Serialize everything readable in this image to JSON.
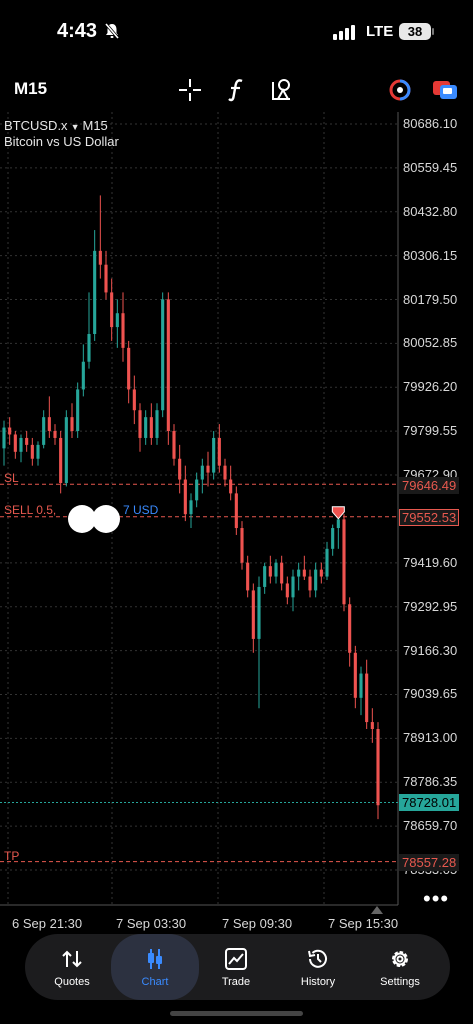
{
  "status": {
    "time": "4:43",
    "network": "LTE",
    "battery": "38"
  },
  "toolbar": {
    "timeframe": "M15",
    "icons": [
      "crosshair-icon",
      "function-icon",
      "objects-icon",
      "chart-color-icon",
      "switch-symbol-icon"
    ]
  },
  "chart_data": {
    "type": "candlestick",
    "symbol": "BTCUSD.x",
    "timeframe": "M15",
    "description": "Bitcoin vs US Dollar",
    "price_ticks": [
      "80686.10",
      "80559.45",
      "80432.80",
      "80306.15",
      "80179.50",
      "80052.85",
      "79926.20",
      "79799.55",
      "79672.90",
      "79419.60",
      "79292.95",
      "79166.30",
      "79039.65",
      "78913.00",
      "78786.35",
      "78659.70",
      "78533.05"
    ],
    "time_ticks": [
      "6 Sep 21:30",
      "7 Sep 03:30",
      "7 Sep 09:30",
      "7 Sep 15:30"
    ],
    "ylim": [
      78533.05,
      80686.1
    ],
    "current_price": "78728.01",
    "sl_price": "79646.49",
    "entry_price": "79552.53",
    "tp_price": "78557.28",
    "sl_label": "SL",
    "tp_label": "TP",
    "order_label_prefix": "SELL 0.5,",
    "order_label_suffix": "7 USD",
    "candles": [
      [
        79750,
        79830,
        79700,
        79810
      ],
      [
        79810,
        79840,
        79760,
        79790
      ],
      [
        79790,
        79800,
        79720,
        79740
      ],
      [
        79740,
        79790,
        79710,
        79780
      ],
      [
        79780,
        79800,
        79740,
        79760
      ],
      [
        79760,
        79780,
        79700,
        79720
      ],
      [
        79720,
        79770,
        79700,
        79760
      ],
      [
        79760,
        79860,
        79750,
        79840
      ],
      [
        79840,
        79900,
        79780,
        79800
      ],
      [
        79800,
        79820,
        79760,
        79780
      ],
      [
        79780,
        79800,
        79620,
        79650
      ],
      [
        79650,
        79860,
        79640,
        79840
      ],
      [
        79840,
        79880,
        79780,
        79800
      ],
      [
        79800,
        79940,
        79780,
        79920
      ],
      [
        79920,
        80050,
        79900,
        80000
      ],
      [
        80000,
        80200,
        79980,
        80080
      ],
      [
        80080,
        80380,
        80060,
        80320
      ],
      [
        80320,
        80480,
        80240,
        80280
      ],
      [
        80280,
        80320,
        80180,
        80200
      ],
      [
        80200,
        80240,
        80060,
        80100
      ],
      [
        80100,
        80180,
        80040,
        80140
      ],
      [
        80140,
        80200,
        80000,
        80040
      ],
      [
        80040,
        80060,
        79880,
        79920
      ],
      [
        79920,
        79960,
        79820,
        79860
      ],
      [
        79860,
        79880,
        79740,
        79780
      ],
      [
        79780,
        79860,
        79760,
        79840
      ],
      [
        79840,
        79880,
        79760,
        79780
      ],
      [
        79780,
        79880,
        79760,
        79860
      ],
      [
        79860,
        80200,
        79840,
        80180
      ],
      [
        80180,
        80200,
        79760,
        79800
      ],
      [
        79800,
        79820,
        79700,
        79720
      ],
      [
        79720,
        79760,
        79620,
        79660
      ],
      [
        79660,
        79700,
        79540,
        79560
      ],
      [
        79560,
        79620,
        79520,
        79600
      ],
      [
        79600,
        79680,
        79580,
        79660
      ],
      [
        79660,
        79720,
        79620,
        79700
      ],
      [
        79700,
        79740,
        79640,
        79680
      ],
      [
        79680,
        79800,
        79660,
        79780
      ],
      [
        79780,
        79820,
        79680,
        79700
      ],
      [
        79700,
        79720,
        79640,
        79660
      ],
      [
        79660,
        79700,
        79600,
        79620
      ],
      [
        79620,
        79640,
        79500,
        79520
      ],
      [
        79520,
        79540,
        79400,
        79420
      ],
      [
        79420,
        79440,
        79320,
        79340
      ],
      [
        79340,
        79360,
        79160,
        79200
      ],
      [
        79200,
        79380,
        79000,
        79350
      ],
      [
        79350,
        79420,
        79330,
        79410
      ],
      [
        79410,
        79440,
        79360,
        79380
      ],
      [
        79380,
        79430,
        79360,
        79420
      ],
      [
        79420,
        79440,
        79340,
        79360
      ],
      [
        79360,
        79380,
        79300,
        79320
      ],
      [
        79320,
        79400,
        79280,
        79380
      ],
      [
        79380,
        79420,
        79340,
        79400
      ],
      [
        79400,
        79440,
        79370,
        79380
      ],
      [
        79380,
        79400,
        79320,
        79340
      ],
      [
        79340,
        79420,
        79320,
        79400
      ],
      [
        79400,
        79420,
        79360,
        79380
      ],
      [
        79380,
        79480,
        79370,
        79460
      ],
      [
        79460,
        79530,
        79440,
        79520
      ],
      [
        79520,
        79560,
        79460,
        79545
      ],
      [
        79545,
        79560,
        79280,
        79300
      ],
      [
        79300,
        79320,
        79120,
        79160
      ],
      [
        79160,
        79180,
        79000,
        79030
      ],
      [
        79030,
        79120,
        78980,
        79100
      ],
      [
        79100,
        79140,
        78940,
        78960
      ],
      [
        78960,
        79000,
        78900,
        78940
      ],
      [
        78940,
        78960,
        78680,
        78720
      ]
    ]
  },
  "tabs": [
    {
      "label": "Quotes",
      "icon": "quotes-icon"
    },
    {
      "label": "Chart",
      "icon": "chart-icon"
    },
    {
      "label": "Trade",
      "icon": "trade-icon"
    },
    {
      "label": "History",
      "icon": "history-icon"
    },
    {
      "label": "Settings",
      "icon": "settings-icon"
    }
  ],
  "colors": {
    "bull": "#26a69a",
    "bear": "#ef5350",
    "grid": "#3a3a3a",
    "accent": "#3a8bff"
  }
}
